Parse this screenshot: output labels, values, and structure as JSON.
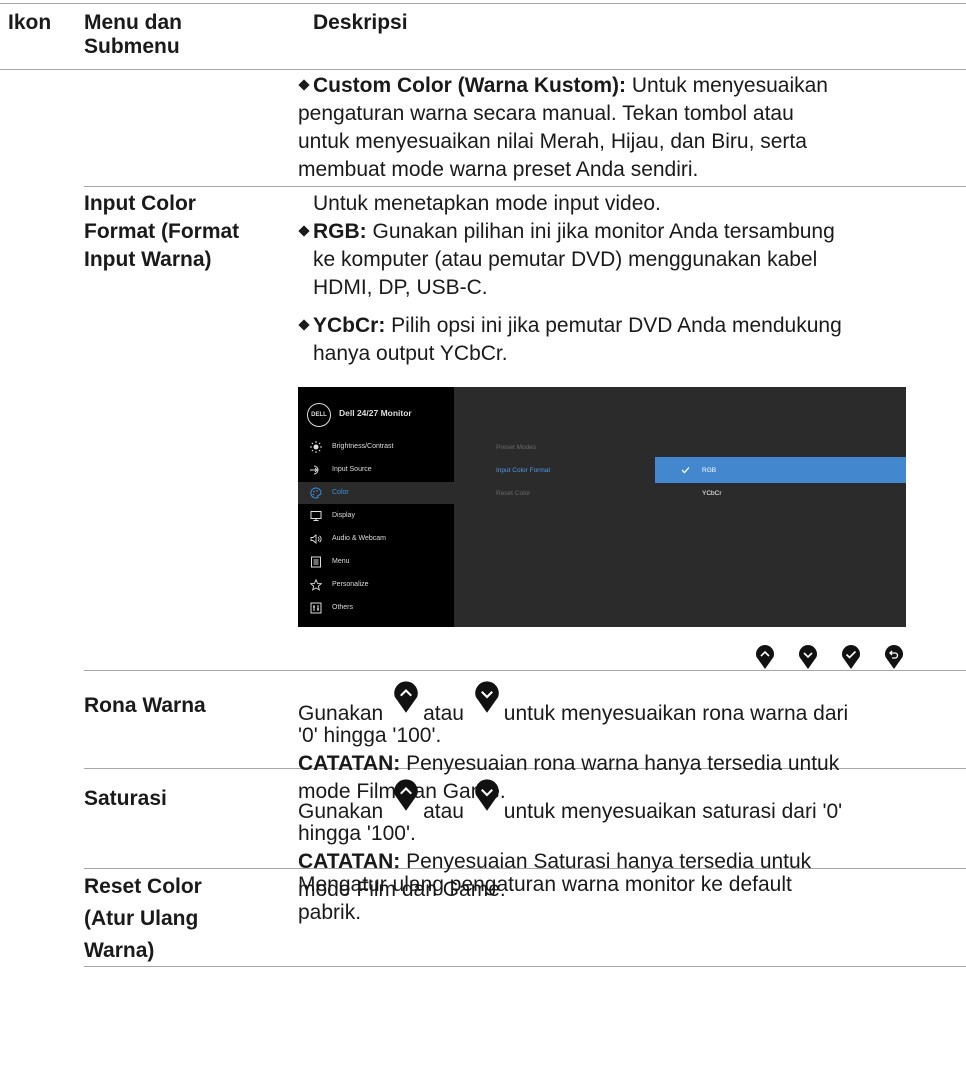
{
  "header": {
    "col_icon": "Ikon",
    "col_menu_line1": "Menu dan",
    "col_menu_line2": "Submenu",
    "col_desc": "Deskripsi"
  },
  "custom_color": {
    "bold": "Custom Color (Warna Kustom):",
    "l1": " Untuk menyesuaikan",
    "l2": "pengaturan warna secara manual. Tekan tombol atau",
    "l3": "untuk menyesuaikan nilai Merah, Hijau, dan Biru, serta",
    "l4": "membuat mode warna preset Anda sendiri."
  },
  "input_color": {
    "label_l1": "Input Color",
    "label_l2": "Format (Format",
    "label_l3": "Input Warna)",
    "intro": "Untuk menetapkan mode input video.",
    "rgb_bold": "RGB:",
    "rgb_l1": " Gunakan pilihan ini jika monitor Anda tersambung",
    "rgb_l2": "ke komputer (atau pemutar DVD) menggunakan kabel",
    "rgb_l3": "HDMI, DP, USB-C.",
    "ycbcr_bold": "YCbCr:",
    "ycbcr_l1": " Pilih opsi ini jika pemutar DVD Anda mendukung",
    "ycbcr_l2": "hanya output YCbCr."
  },
  "osd": {
    "logo": "DELL",
    "title": "Dell 24/27 Monitor",
    "menu": [
      "Brightness/Contrast",
      "Input Source",
      "Color",
      "Display",
      "Audio & Webcam",
      "Menu",
      "Personalize",
      "Others"
    ],
    "menu_icons": [
      "brightness-icon",
      "input-source-icon",
      "color-palette-icon",
      "display-icon",
      "audio-icon",
      "menu-icon",
      "star-icon",
      "others-icon"
    ],
    "sub": [
      "Preset Modes",
      "Input Color Format",
      "Reset Color"
    ],
    "options": [
      "RGB",
      "YCbCr"
    ],
    "accent": "#4387cf"
  },
  "nav_buttons": [
    "up-icon",
    "down-icon",
    "check-icon",
    "back-icon"
  ],
  "hue": {
    "label": "Rona Warna",
    "pre": "Gunakan",
    "mid": "atau",
    "post": "untuk menyesuaikan rona warna dari",
    "l2": "'0' hingga '100'.",
    "note_bold": "CATATAN:",
    "note_l1": " Penyesuaian rona warna hanya tersedia untuk",
    "note_l2": "mode Film dan Game."
  },
  "saturation": {
    "label": "Saturasi",
    "pre": "Gunakan",
    "mid": "atau",
    "post": "untuk menyesuaikan saturasi dari '0'",
    "l2": "hingga '100'.",
    "note_bold": "CATATAN:",
    "note_l1": " Penyesuaian Saturasi hanya tersedia untuk",
    "note_l2": "mode Film dan Game."
  },
  "reset": {
    "label_l1": "Reset Color",
    "label_l2": "(Atur Ulang",
    "label_l3": "Warna)",
    "l1": "Mengatur ulang pengaturan warna monitor ke default",
    "l2": "pabrik."
  }
}
